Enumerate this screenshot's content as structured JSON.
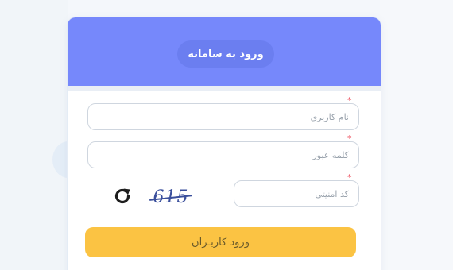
{
  "form": {
    "title": "ورود به سامانه",
    "username_placeholder": "نام کاربری",
    "password_placeholder": "کلمه عبور",
    "captcha_placeholder": "کد امنیتی",
    "captcha_value": "615",
    "required_mark": "*",
    "submit_label": "ورود کاربـران"
  },
  "colors": {
    "header": "#7688fb",
    "title_pill": "#6b7ef0",
    "submit": "#fbc343",
    "required": "#ef5b6a"
  }
}
